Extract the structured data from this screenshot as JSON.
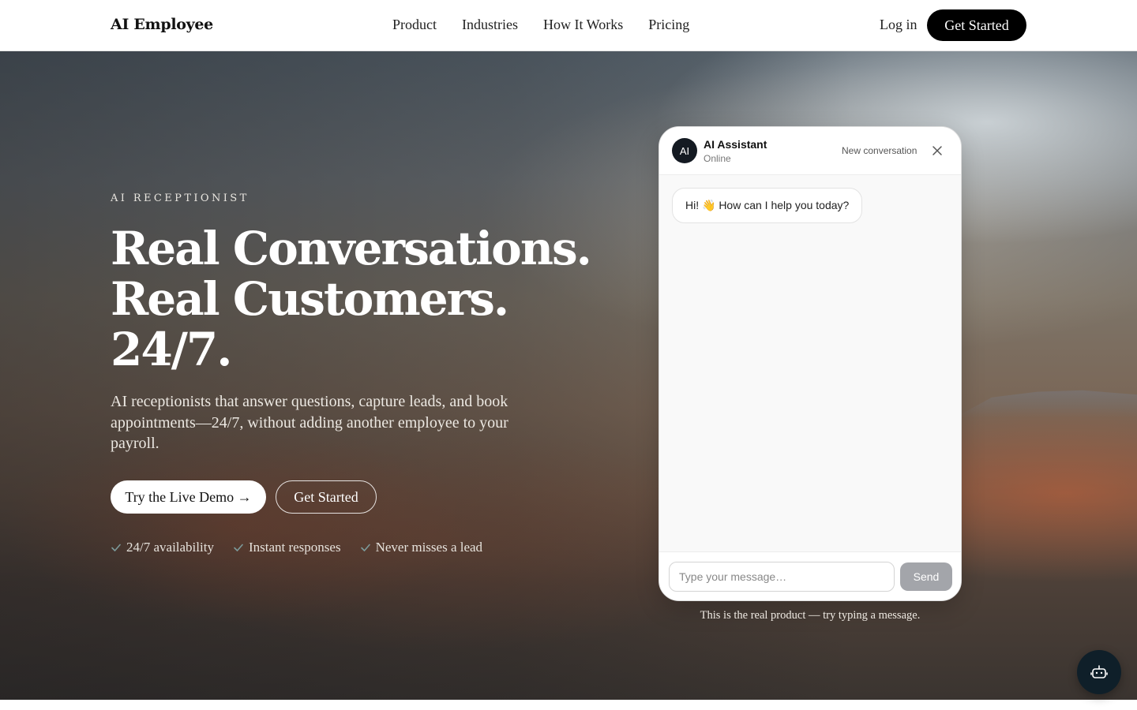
{
  "nav": {
    "brand": "AI Employee",
    "links": [
      "Product",
      "Industries",
      "How It Works",
      "Pricing"
    ],
    "login": "Log in",
    "cta": "Get Started"
  },
  "hero": {
    "eyebrow": "AI RECEPTIONIST",
    "headline": [
      "Real Conversations.",
      "Real Customers.",
      "24/7."
    ],
    "subcopy": "AI receptionists that answer questions, capture leads, and book appointments—24/7, without adding another employee to your payroll.",
    "primary_button": "Try the Live Demo →",
    "secondary_button": "Get Started",
    "features": [
      "24/7 availability",
      "Instant responses",
      "Never misses a lead"
    ]
  },
  "chat": {
    "avatar": "AI",
    "name": "AI Assistant",
    "status": "Online",
    "new_conversation": "New conversation",
    "messages": [
      {
        "from": "assistant",
        "text": "Hi! 👋 How can I help you today?"
      }
    ],
    "input_placeholder": "Type your message…",
    "input_value": "",
    "send_label": "Send",
    "caption": "This is the real product — try typing a message."
  },
  "colors": {
    "primary": "#000000",
    "chat_avatar": "#141a22",
    "send_disabled": "#a3a5aa",
    "fab": "#0f1f29",
    "check": "#6f8a8a"
  },
  "icons": {
    "close": "close-icon",
    "check": "check-icon",
    "fab": "robot-icon"
  }
}
